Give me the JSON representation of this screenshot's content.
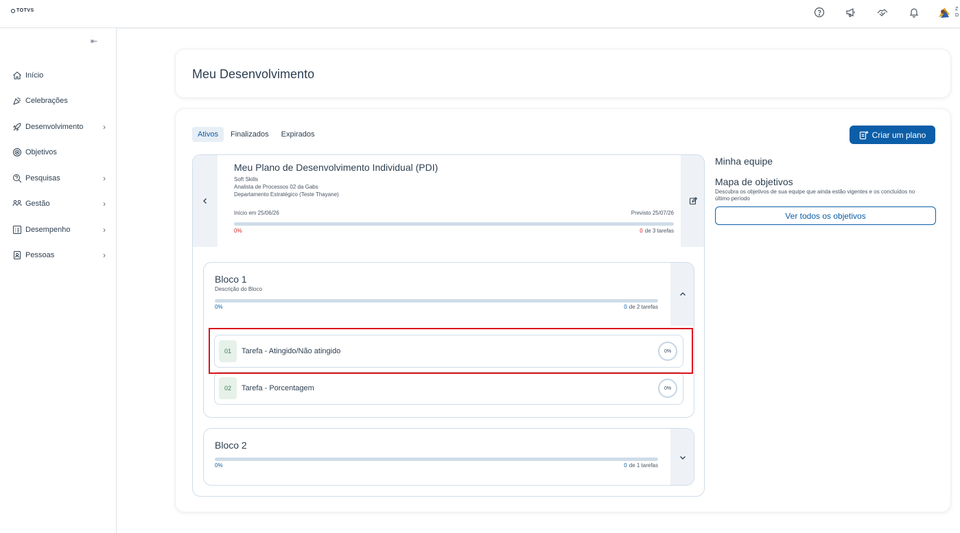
{
  "app": {
    "logo_text": "TOTVS",
    "user_initials_1": "Z",
    "user_initials_2": "D"
  },
  "topbar": {
    "icons": [
      "help-icon",
      "megaphone-icon",
      "handshake-icon",
      "bell-icon"
    ]
  },
  "sidebar": {
    "items": [
      {
        "label": "Início",
        "icon": "home-icon",
        "has_children": false
      },
      {
        "label": "Celebrações",
        "icon": "party-icon",
        "has_children": false
      },
      {
        "label": "Desenvolvimento",
        "icon": "rocket-icon",
        "has_children": true
      },
      {
        "label": "Objetivos",
        "icon": "target-icon",
        "has_children": false
      },
      {
        "label": "Pesquisas",
        "icon": "survey-icon",
        "has_children": true
      },
      {
        "label": "Gestão",
        "icon": "people-icon",
        "has_children": true
      },
      {
        "label": "Desempenho",
        "icon": "list-icon",
        "has_children": true
      },
      {
        "label": "Pessoas",
        "icon": "badge-icon",
        "has_children": true
      }
    ]
  },
  "page": {
    "title": "Meu Desenvolvimento"
  },
  "tabs": [
    {
      "label": "Ativos",
      "active": true
    },
    {
      "label": "Finalizados",
      "active": false
    },
    {
      "label": "Expirados",
      "active": false
    }
  ],
  "create_button": {
    "label": "Criar um plano"
  },
  "plan": {
    "title": "Meu Plano de Desenvolvimento Individual (PDI)",
    "lines": [
      "Soft Skills",
      "Analista de Processos 02 da Gabs",
      "Departamento Estratégico (Teste Thayane)"
    ],
    "start": "Início em 25/06/26",
    "due": "Previsto 25/07/26",
    "progress": 0,
    "progress_label": "0%",
    "done": "0",
    "total_label": "de 3 tarefas"
  },
  "blocks": [
    {
      "title": "Bloco 1",
      "description": "Descrição do Bloco",
      "progress": 0,
      "progress_label": "0%",
      "done": "0",
      "total_label": "de 2 tarefas",
      "expanded": true,
      "tasks": [
        {
          "num": "01",
          "name": "Tarefa - Atingido/Não atingido",
          "pct": "0%"
        },
        {
          "num": "02",
          "name": "Tarefa - Porcentagem",
          "pct": "0%"
        }
      ]
    },
    {
      "title": "Bloco 2",
      "description": "",
      "progress": 0,
      "progress_label": "0%",
      "done": "0",
      "total_label": "de 1 tarefas",
      "expanded": false,
      "tasks": []
    }
  ],
  "team": {
    "title": "Minha equipe",
    "map_title": "Mapa de objetivos",
    "map_description": "Descubra os objetivos de sua equipe que ainda estão vigentes e os concluídos no último período",
    "button": "Ver todos os objetivos"
  },
  "colors": {
    "primary": "#0c5ea8",
    "danger": "#d1221f",
    "highlight": "#d9131b"
  }
}
